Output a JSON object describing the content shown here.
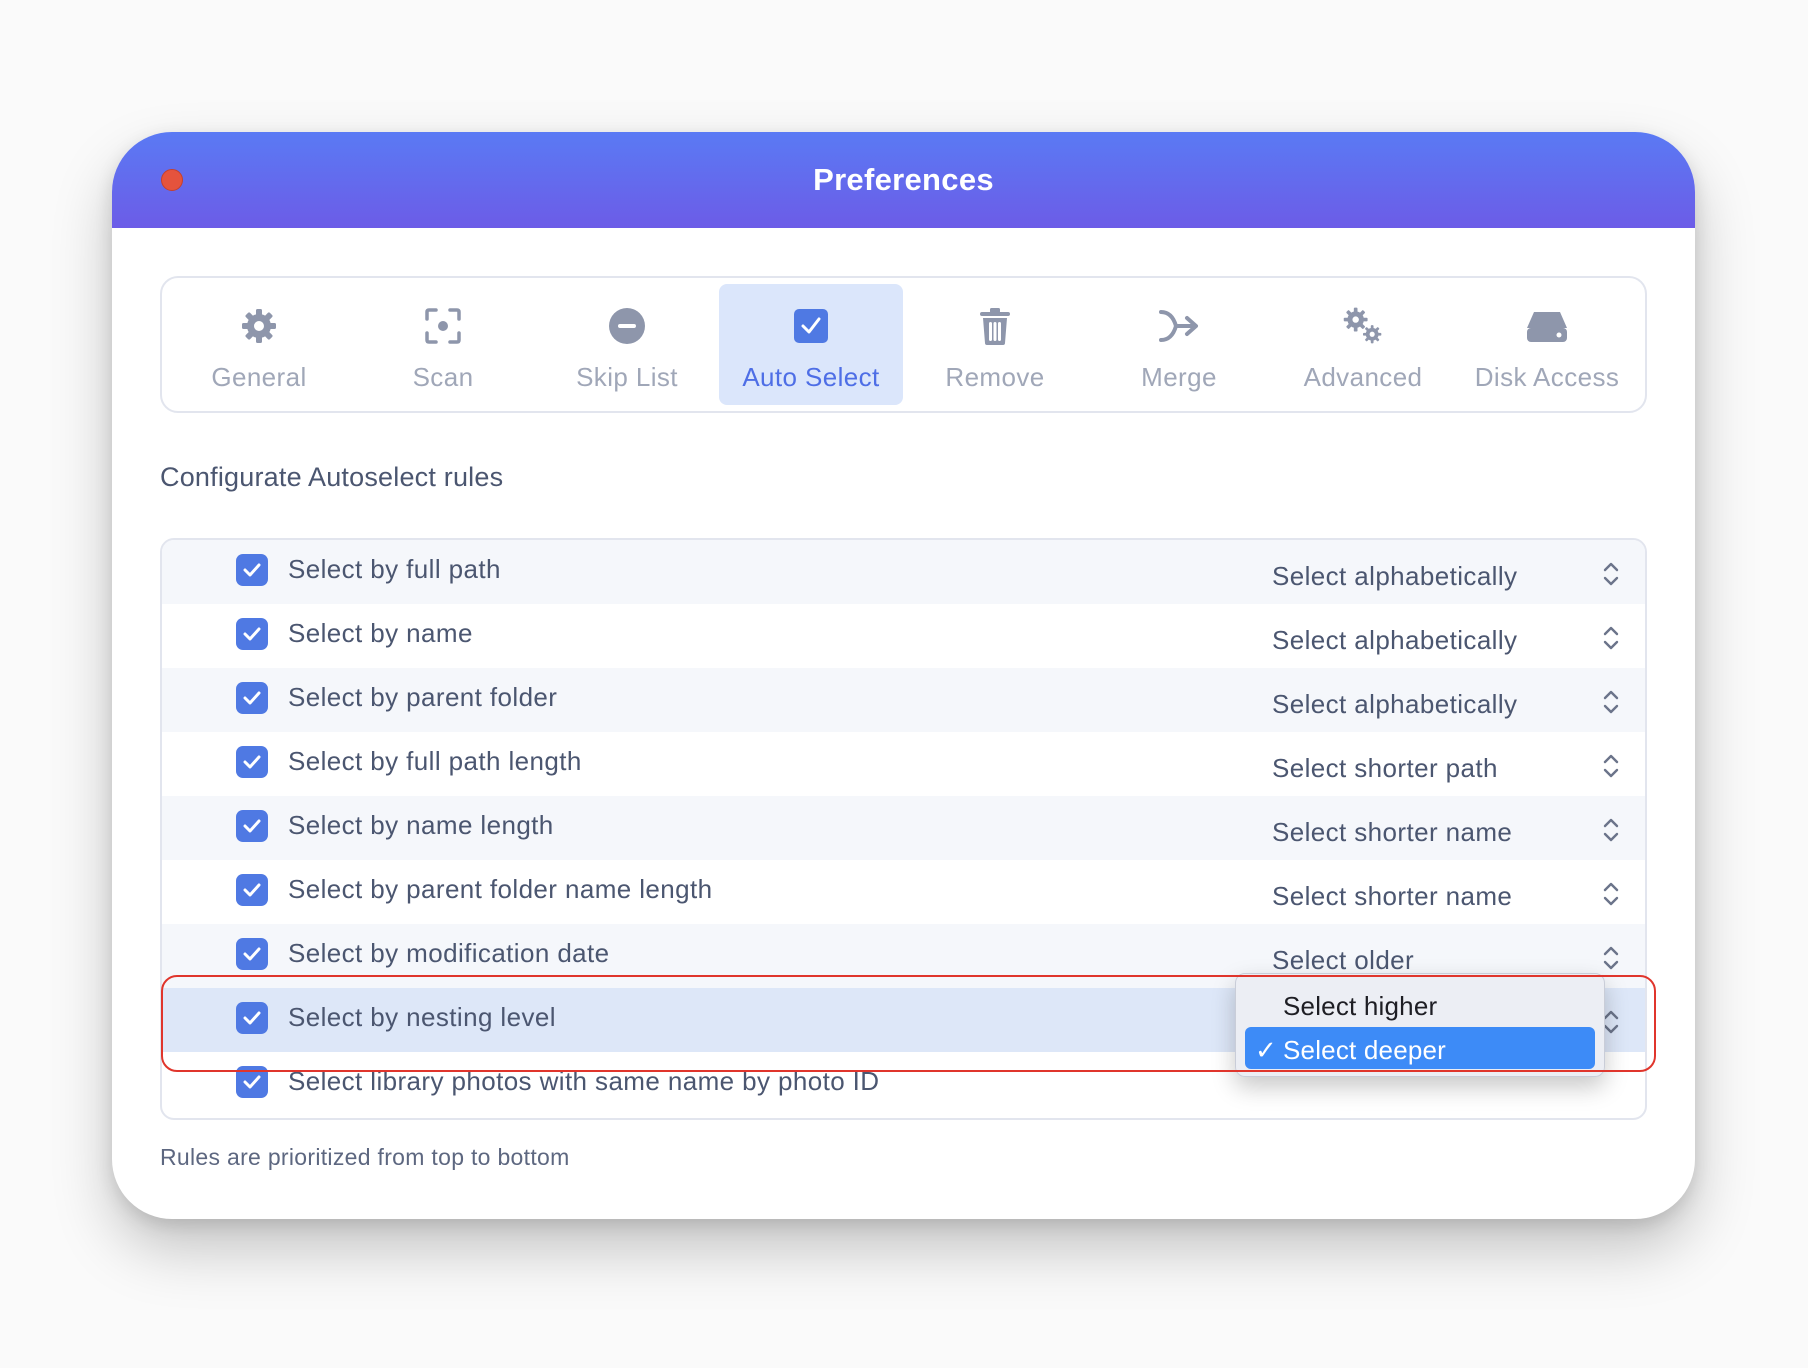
{
  "window": {
    "title": "Preferences"
  },
  "toolbar": {
    "tabs": [
      {
        "label": "General",
        "icon": "gear-icon"
      },
      {
        "label": "Scan",
        "icon": "scan-icon"
      },
      {
        "label": "Skip List",
        "icon": "minus-circle-icon"
      },
      {
        "label": "Auto Select",
        "icon": "checkbox-icon",
        "active": true
      },
      {
        "label": "Remove",
        "icon": "trash-icon"
      },
      {
        "label": "Merge",
        "icon": "merge-arrow-icon"
      },
      {
        "label": "Advanced",
        "icon": "gears-icon"
      },
      {
        "label": "Disk Access",
        "icon": "disk-icon"
      }
    ]
  },
  "main": {
    "section_title": "Configurate Autoselect rules",
    "rules": [
      {
        "label": "Select by full path",
        "checked": true,
        "option": "Select alphabetically"
      },
      {
        "label": "Select by name",
        "checked": true,
        "option": "Select alphabetically"
      },
      {
        "label": "Select by parent folder",
        "checked": true,
        "option": "Select alphabetically"
      },
      {
        "label": "Select by full path length",
        "checked": true,
        "option": "Select shorter path"
      },
      {
        "label": "Select by name length",
        "checked": true,
        "option": "Select shorter name"
      },
      {
        "label": "Select by parent folder name length",
        "checked": true,
        "option": "Select shorter name"
      },
      {
        "label": "Select by modification date",
        "checked": true,
        "option": "Select older"
      },
      {
        "label": "Select by nesting level",
        "checked": true,
        "option": "Select deeper",
        "selected": true
      },
      {
        "label": "Select library photos with same name by photo ID",
        "checked": true
      }
    ],
    "footnote": "Rules are prioritized from top to bottom"
  },
  "dropdown": {
    "options": [
      {
        "label": "Select higher",
        "checked": false
      },
      {
        "label": "Select deeper",
        "checked": true
      }
    ],
    "check_glyph": "✓"
  },
  "colors": {
    "titlebar_start": "#5a7af4",
    "titlebar_end": "#6c5ce7",
    "accent": "#4f79e3",
    "active_tab_bg": "#dbe6fb",
    "dropdown_selected": "#3d8bf7",
    "highlight_border": "#e0352c"
  }
}
